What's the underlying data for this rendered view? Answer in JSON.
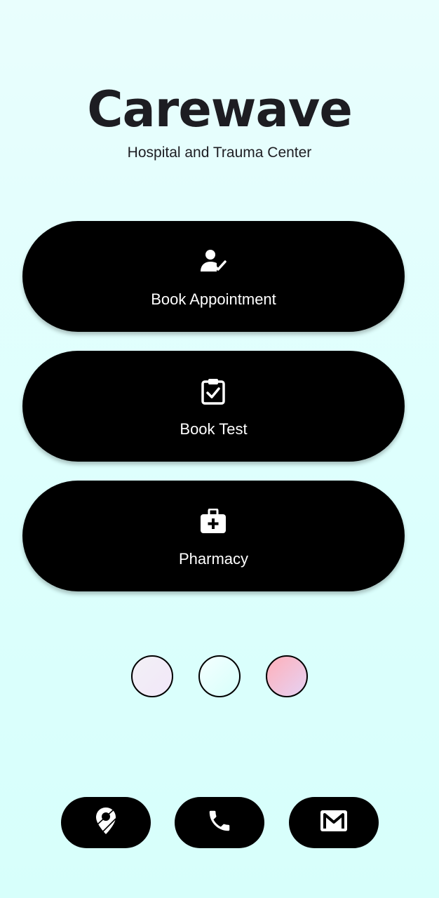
{
  "header": {
    "title": "Carewave",
    "subtitle": "Hospital and Trauma Center"
  },
  "menu": [
    {
      "label": "Book Appointment",
      "icon": "person-check-icon"
    },
    {
      "label": "Book Test",
      "icon": "clipboard-check-icon"
    },
    {
      "label": "Pharmacy",
      "icon": "medical-bag-icon"
    }
  ],
  "theme_swatches": [
    {
      "name": "lavender",
      "colors": [
        "#f3f0f6",
        "#f1e7f8"
      ]
    },
    {
      "name": "aqua",
      "colors": [
        "#f4ffff",
        "#d7fffb"
      ]
    },
    {
      "name": "rose",
      "colors": [
        "#ffb0b9",
        "#e6d2f4"
      ]
    }
  ],
  "contact": [
    {
      "icon": "location-pin-icon"
    },
    {
      "icon": "phone-icon"
    },
    {
      "icon": "mail-icon"
    }
  ],
  "colors": {
    "card": "#000000",
    "card_text": "#ffffff",
    "title": "#1d1d22"
  }
}
